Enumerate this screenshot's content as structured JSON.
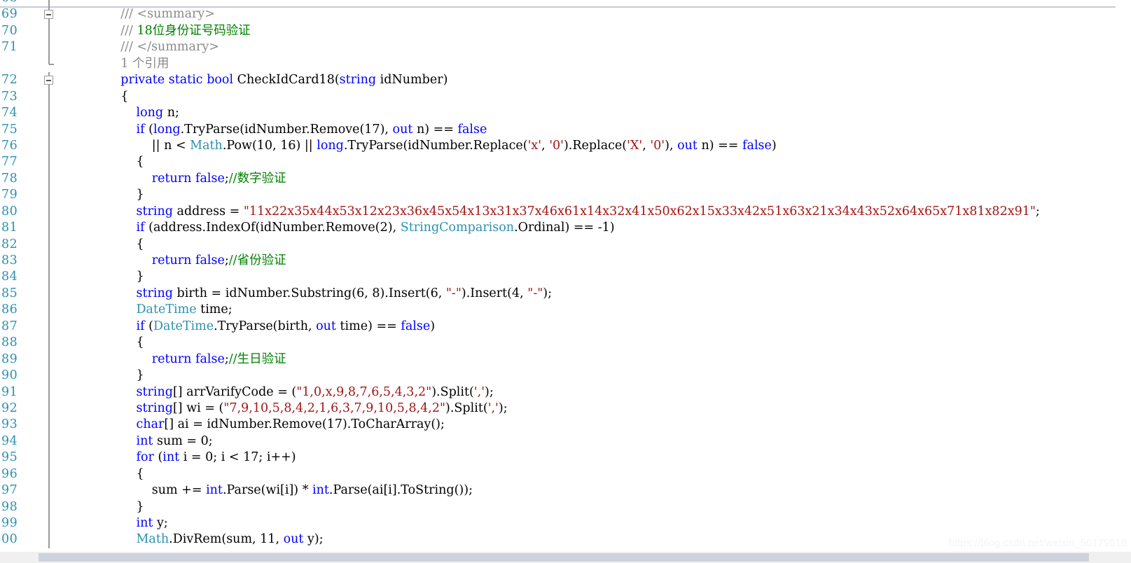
{
  "editor": {
    "language": "csharp",
    "colors": {
      "keyword": "#0000FF",
      "type": "#2B91AF",
      "string": "#A31515",
      "comment": "#008000",
      "plain": "#000000",
      "line_number": "#2B91AF",
      "codelens": "#8A8A8A",
      "background": "#FFFFFF",
      "scrollbar_thumb": "#CDD3DC"
    },
    "first_visible_line": 68,
    "last_visible_line": 100,
    "fold_markers": [
      69,
      72
    ]
  },
  "watermark": {
    "text": "https://blog.csdn.net/weixin_50179616"
  },
  "lines": [
    {
      "num": "68",
      "fold": "line",
      "clipped": true,
      "tokens": []
    },
    {
      "num": "69",
      "fold": "box",
      "tokens": [
        {
          "t": "    ",
          "c": "pln"
        },
        {
          "t": "/// <summary>",
          "c": "lens"
        }
      ]
    },
    {
      "num": "70",
      "fold": "line",
      "tokens": [
        {
          "t": "    ",
          "c": "pln"
        },
        {
          "t": "/// ",
          "c": "lens"
        },
        {
          "t": "18位身份证号码验证",
          "c": "cmt"
        }
      ]
    },
    {
      "num": "71",
      "fold": "line",
      "tokens": [
        {
          "t": "    ",
          "c": "pln"
        },
        {
          "t": "/// </summary>",
          "c": "lens"
        }
      ]
    },
    {
      "num": "",
      "fold": "stub",
      "codelens": true,
      "tokens": [
        {
          "t": "    ",
          "c": "pln"
        },
        {
          "t": "1 个引用",
          "c": "lens"
        }
      ]
    },
    {
      "num": "72",
      "fold": "box",
      "tokens": [
        {
          "t": "    ",
          "c": "pln"
        },
        {
          "t": "private",
          "c": "kw"
        },
        {
          "t": " ",
          "c": "pln"
        },
        {
          "t": "static",
          "c": "kw"
        },
        {
          "t": " ",
          "c": "pln"
        },
        {
          "t": "bool",
          "c": "kw"
        },
        {
          "t": " CheckIdCard18(",
          "c": "pln"
        },
        {
          "t": "string",
          "c": "kw"
        },
        {
          "t": " idNumber)",
          "c": "pln"
        }
      ]
    },
    {
      "num": "73",
      "fold": "line",
      "tokens": [
        {
          "t": "    {",
          "c": "pln"
        }
      ]
    },
    {
      "num": "74",
      "fold": "line",
      "tokens": [
        {
          "t": "        ",
          "c": "pln"
        },
        {
          "t": "long",
          "c": "kw"
        },
        {
          "t": " n;",
          "c": "pln"
        }
      ]
    },
    {
      "num": "75",
      "fold": "line",
      "tokens": [
        {
          "t": "        ",
          "c": "pln"
        },
        {
          "t": "if",
          "c": "kw"
        },
        {
          "t": " (",
          "c": "pln"
        },
        {
          "t": "long",
          "c": "kw"
        },
        {
          "t": ".TryParse(idNumber.Remove(17), ",
          "c": "pln"
        },
        {
          "t": "out",
          "c": "kw"
        },
        {
          "t": " n) == ",
          "c": "pln"
        },
        {
          "t": "false",
          "c": "kw"
        }
      ]
    },
    {
      "num": "76",
      "fold": "line",
      "tokens": [
        {
          "t": "            || n < ",
          "c": "pln"
        },
        {
          "t": "Math",
          "c": "typ"
        },
        {
          "t": ".Pow(10, 16) || ",
          "c": "pln"
        },
        {
          "t": "long",
          "c": "kw"
        },
        {
          "t": ".TryParse(idNumber.Replace(",
          "c": "pln"
        },
        {
          "t": "'x'",
          "c": "str"
        },
        {
          "t": ", ",
          "c": "pln"
        },
        {
          "t": "'0'",
          "c": "str"
        },
        {
          "t": ").Replace(",
          "c": "pln"
        },
        {
          "t": "'X'",
          "c": "str"
        },
        {
          "t": ", ",
          "c": "pln"
        },
        {
          "t": "'0'",
          "c": "str"
        },
        {
          "t": "), ",
          "c": "pln"
        },
        {
          "t": "out",
          "c": "kw"
        },
        {
          "t": " n) == ",
          "c": "pln"
        },
        {
          "t": "false",
          "c": "kw"
        },
        {
          "t": ")",
          "c": "pln"
        }
      ]
    },
    {
      "num": "77",
      "fold": "line",
      "tokens": [
        {
          "t": "        {",
          "c": "pln"
        }
      ]
    },
    {
      "num": "78",
      "fold": "line",
      "tokens": [
        {
          "t": "            ",
          "c": "pln"
        },
        {
          "t": "return",
          "c": "kw"
        },
        {
          "t": " ",
          "c": "pln"
        },
        {
          "t": "false",
          "c": "kw"
        },
        {
          "t": ";",
          "c": "pln"
        },
        {
          "t": "//数字验证",
          "c": "cmt"
        }
      ]
    },
    {
      "num": "79",
      "fold": "line",
      "tokens": [
        {
          "t": "        }",
          "c": "pln"
        }
      ]
    },
    {
      "num": "80",
      "fold": "line",
      "tokens": [
        {
          "t": "        ",
          "c": "pln"
        },
        {
          "t": "string",
          "c": "kw"
        },
        {
          "t": " address = ",
          "c": "pln"
        },
        {
          "t": "\"11x22x35x44x53x12x23x36x45x54x13x31x37x46x61x14x32x41x50x62x15x33x42x51x63x21x34x43x52x64x65x71x81x82x91\"",
          "c": "str"
        },
        {
          "t": ";",
          "c": "pln"
        }
      ]
    },
    {
      "num": "81",
      "fold": "line",
      "tokens": [
        {
          "t": "        ",
          "c": "pln"
        },
        {
          "t": "if",
          "c": "kw"
        },
        {
          "t": " (address.IndexOf(idNumber.Remove(2), ",
          "c": "pln"
        },
        {
          "t": "StringComparison",
          "c": "typ"
        },
        {
          "t": ".Ordinal) == -1)",
          "c": "pln"
        }
      ]
    },
    {
      "num": "82",
      "fold": "line",
      "tokens": [
        {
          "t": "        {",
          "c": "pln"
        }
      ]
    },
    {
      "num": "83",
      "fold": "line",
      "tokens": [
        {
          "t": "            ",
          "c": "pln"
        },
        {
          "t": "return",
          "c": "kw"
        },
        {
          "t": " ",
          "c": "pln"
        },
        {
          "t": "false",
          "c": "kw"
        },
        {
          "t": ";",
          "c": "pln"
        },
        {
          "t": "//省份验证",
          "c": "cmt"
        }
      ]
    },
    {
      "num": "84",
      "fold": "line",
      "tokens": [
        {
          "t": "        }",
          "c": "pln"
        }
      ]
    },
    {
      "num": "85",
      "fold": "line",
      "tokens": [
        {
          "t": "        ",
          "c": "pln"
        },
        {
          "t": "string",
          "c": "kw"
        },
        {
          "t": " birth = idNumber.Substring(6, 8).Insert(6, ",
          "c": "pln"
        },
        {
          "t": "\"-\"",
          "c": "str"
        },
        {
          "t": ").Insert(4, ",
          "c": "pln"
        },
        {
          "t": "\"-\"",
          "c": "str"
        },
        {
          "t": ");",
          "c": "pln"
        }
      ]
    },
    {
      "num": "86",
      "fold": "line",
      "tokens": [
        {
          "t": "        ",
          "c": "pln"
        },
        {
          "t": "DateTime",
          "c": "typ"
        },
        {
          "t": " time;",
          "c": "pln"
        }
      ]
    },
    {
      "num": "87",
      "fold": "line",
      "tokens": [
        {
          "t": "        ",
          "c": "pln"
        },
        {
          "t": "if",
          "c": "kw"
        },
        {
          "t": " (",
          "c": "pln"
        },
        {
          "t": "DateTime",
          "c": "typ"
        },
        {
          "t": ".TryParse(birth, ",
          "c": "pln"
        },
        {
          "t": "out",
          "c": "kw"
        },
        {
          "t": " time) == ",
          "c": "pln"
        },
        {
          "t": "false",
          "c": "kw"
        },
        {
          "t": ")",
          "c": "pln"
        }
      ]
    },
    {
      "num": "88",
      "fold": "line",
      "tokens": [
        {
          "t": "        {",
          "c": "pln"
        }
      ]
    },
    {
      "num": "89",
      "fold": "line",
      "tokens": [
        {
          "t": "            ",
          "c": "pln"
        },
        {
          "t": "return",
          "c": "kw"
        },
        {
          "t": " ",
          "c": "pln"
        },
        {
          "t": "false",
          "c": "kw"
        },
        {
          "t": ";",
          "c": "pln"
        },
        {
          "t": "//生日验证",
          "c": "cmt"
        }
      ]
    },
    {
      "num": "90",
      "fold": "line",
      "tokens": [
        {
          "t": "        }",
          "c": "pln"
        }
      ]
    },
    {
      "num": "91",
      "fold": "line",
      "tokens": [
        {
          "t": "        ",
          "c": "pln"
        },
        {
          "t": "string",
          "c": "kw"
        },
        {
          "t": "[] arrVarifyCode = (",
          "c": "pln"
        },
        {
          "t": "\"1,0,x,9,8,7,6,5,4,3,2\"",
          "c": "str"
        },
        {
          "t": ").Split(",
          "c": "pln"
        },
        {
          "t": "','",
          "c": "str"
        },
        {
          "t": ");",
          "c": "pln"
        }
      ]
    },
    {
      "num": "92",
      "fold": "line",
      "tokens": [
        {
          "t": "        ",
          "c": "pln"
        },
        {
          "t": "string",
          "c": "kw"
        },
        {
          "t": "[] wi = (",
          "c": "pln"
        },
        {
          "t": "\"7,9,10,5,8,4,2,1,6,3,7,9,10,5,8,4,2\"",
          "c": "str"
        },
        {
          "t": ").Split(",
          "c": "pln"
        },
        {
          "t": "','",
          "c": "str"
        },
        {
          "t": ");",
          "c": "pln"
        }
      ]
    },
    {
      "num": "93",
      "fold": "line",
      "tokens": [
        {
          "t": "        ",
          "c": "pln"
        },
        {
          "t": "char",
          "c": "kw"
        },
        {
          "t": "[] ai = idNumber.Remove(17).ToCharArray();",
          "c": "pln"
        }
      ]
    },
    {
      "num": "94",
      "fold": "line",
      "tokens": [
        {
          "t": "        ",
          "c": "pln"
        },
        {
          "t": "int",
          "c": "kw"
        },
        {
          "t": " sum = 0;",
          "c": "pln"
        }
      ]
    },
    {
      "num": "95",
      "fold": "line",
      "tokens": [
        {
          "t": "        ",
          "c": "pln"
        },
        {
          "t": "for",
          "c": "kw"
        },
        {
          "t": " (",
          "c": "pln"
        },
        {
          "t": "int",
          "c": "kw"
        },
        {
          "t": " i = 0; i < 17; i++)",
          "c": "pln"
        }
      ]
    },
    {
      "num": "96",
      "fold": "line",
      "tokens": [
        {
          "t": "        {",
          "c": "pln"
        }
      ]
    },
    {
      "num": "97",
      "fold": "line",
      "tokens": [
        {
          "t": "            sum += ",
          "c": "pln"
        },
        {
          "t": "int",
          "c": "kw"
        },
        {
          "t": ".Parse(wi[i]) * ",
          "c": "pln"
        },
        {
          "t": "int",
          "c": "kw"
        },
        {
          "t": ".Parse(ai[i].ToString());",
          "c": "pln"
        }
      ]
    },
    {
      "num": "98",
      "fold": "line",
      "tokens": [
        {
          "t": "        }",
          "c": "pln"
        }
      ]
    },
    {
      "num": "99",
      "fold": "line",
      "tokens": [
        {
          "t": "        ",
          "c": "pln"
        },
        {
          "t": "int",
          "c": "kw"
        },
        {
          "t": " y;",
          "c": "pln"
        }
      ]
    },
    {
      "num": "00",
      "fold": "line",
      "clipped_bottom": true,
      "tokens": [
        {
          "t": "        ",
          "c": "pln"
        },
        {
          "t": "Math",
          "c": "typ"
        },
        {
          "t": ".DivRem(sum, 11, ",
          "c": "pln"
        },
        {
          "t": "out",
          "c": "kw"
        },
        {
          "t": " y);",
          "c": "pln"
        }
      ]
    }
  ]
}
